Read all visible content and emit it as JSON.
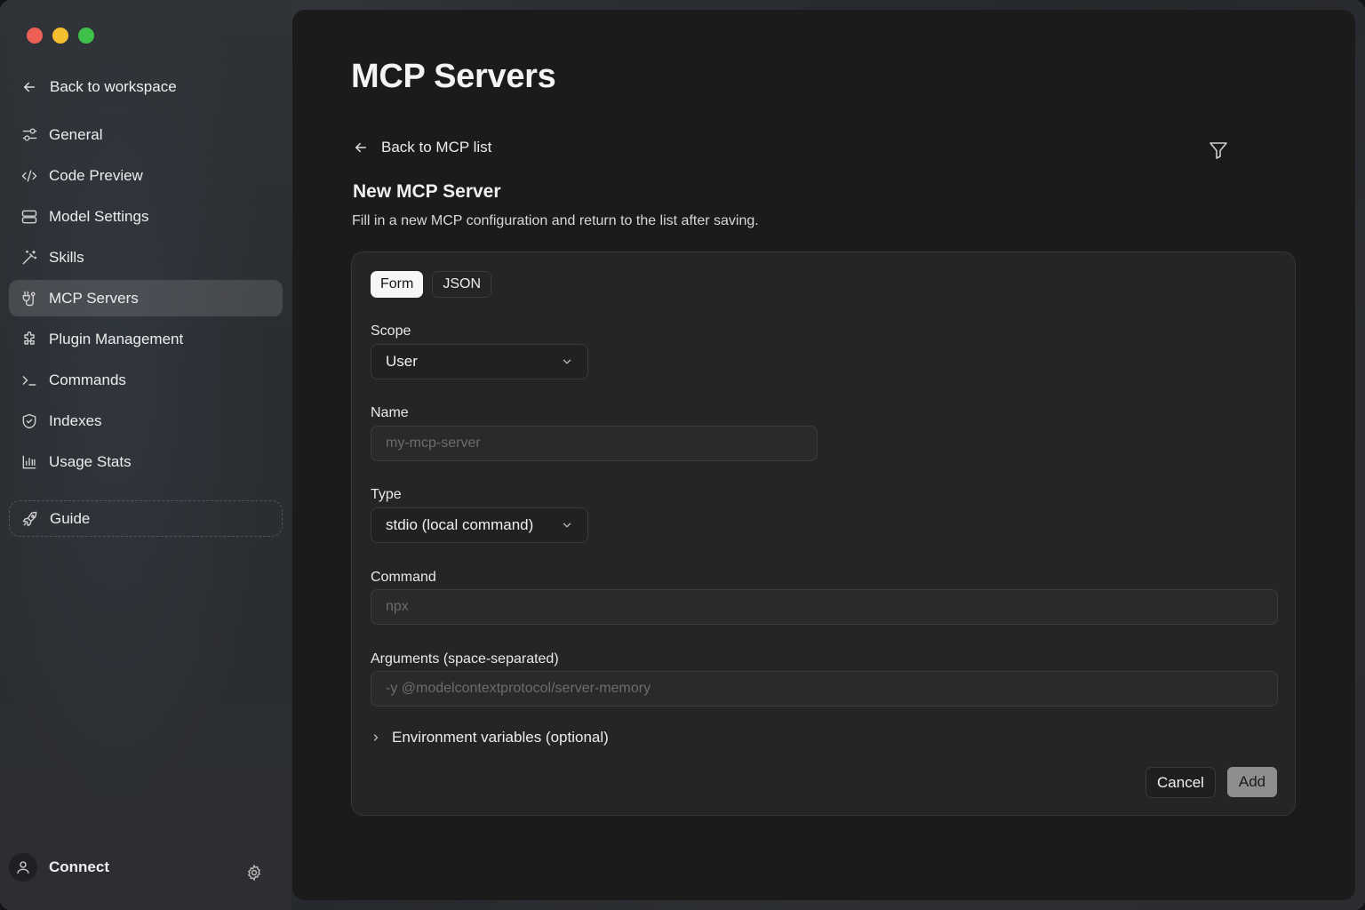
{
  "window": {
    "traffic_lights": [
      "close",
      "minimize",
      "zoom"
    ]
  },
  "sidebar": {
    "back_label": "Back to workspace",
    "items": [
      {
        "label": "General",
        "icon": "sliders-icon"
      },
      {
        "label": "Code Preview",
        "icon": "code-icon"
      },
      {
        "label": "Model Settings",
        "icon": "server-icon"
      },
      {
        "label": "Skills",
        "icon": "wand-icon"
      },
      {
        "label": "MCP Servers",
        "icon": "plug-icon",
        "active": true
      },
      {
        "label": "Plugin Management",
        "icon": "puzzle-icon"
      },
      {
        "label": "Commands",
        "icon": "terminal-icon"
      },
      {
        "label": "Indexes",
        "icon": "shield-icon"
      },
      {
        "label": "Usage Stats",
        "icon": "bar-chart-icon"
      }
    ],
    "guide_label": "Guide",
    "user_name": "Connect"
  },
  "main": {
    "title": "MCP Servers",
    "back_label": "Back to MCP list",
    "section_title": "New MCP Server",
    "section_desc": "Fill in a new MCP configuration and return to the list after saving.",
    "tabs": [
      {
        "label": "Form",
        "active": true
      },
      {
        "label": "JSON",
        "active": false
      }
    ],
    "form": {
      "scope": {
        "label": "Scope",
        "value": "User"
      },
      "name": {
        "label": "Name",
        "value": "",
        "placeholder": "my-mcp-server"
      },
      "type": {
        "label": "Type",
        "value": "stdio (local command)"
      },
      "command": {
        "label": "Command",
        "value": "",
        "placeholder": "npx"
      },
      "arguments": {
        "label": "Arguments (space-separated)",
        "value": "",
        "placeholder": "-y @modelcontextprotocol/server-memory"
      },
      "env_label": "Environment variables (optional)"
    },
    "actions": {
      "cancel": "Cancel",
      "add": "Add"
    }
  },
  "colors": {
    "traffic_red": "#ed5f57",
    "traffic_yellow": "#f4bf2f",
    "traffic_green": "#3fc04a",
    "active_tab_bg": "#f6f6f6",
    "add_button_bg": "#8e8e8e"
  }
}
